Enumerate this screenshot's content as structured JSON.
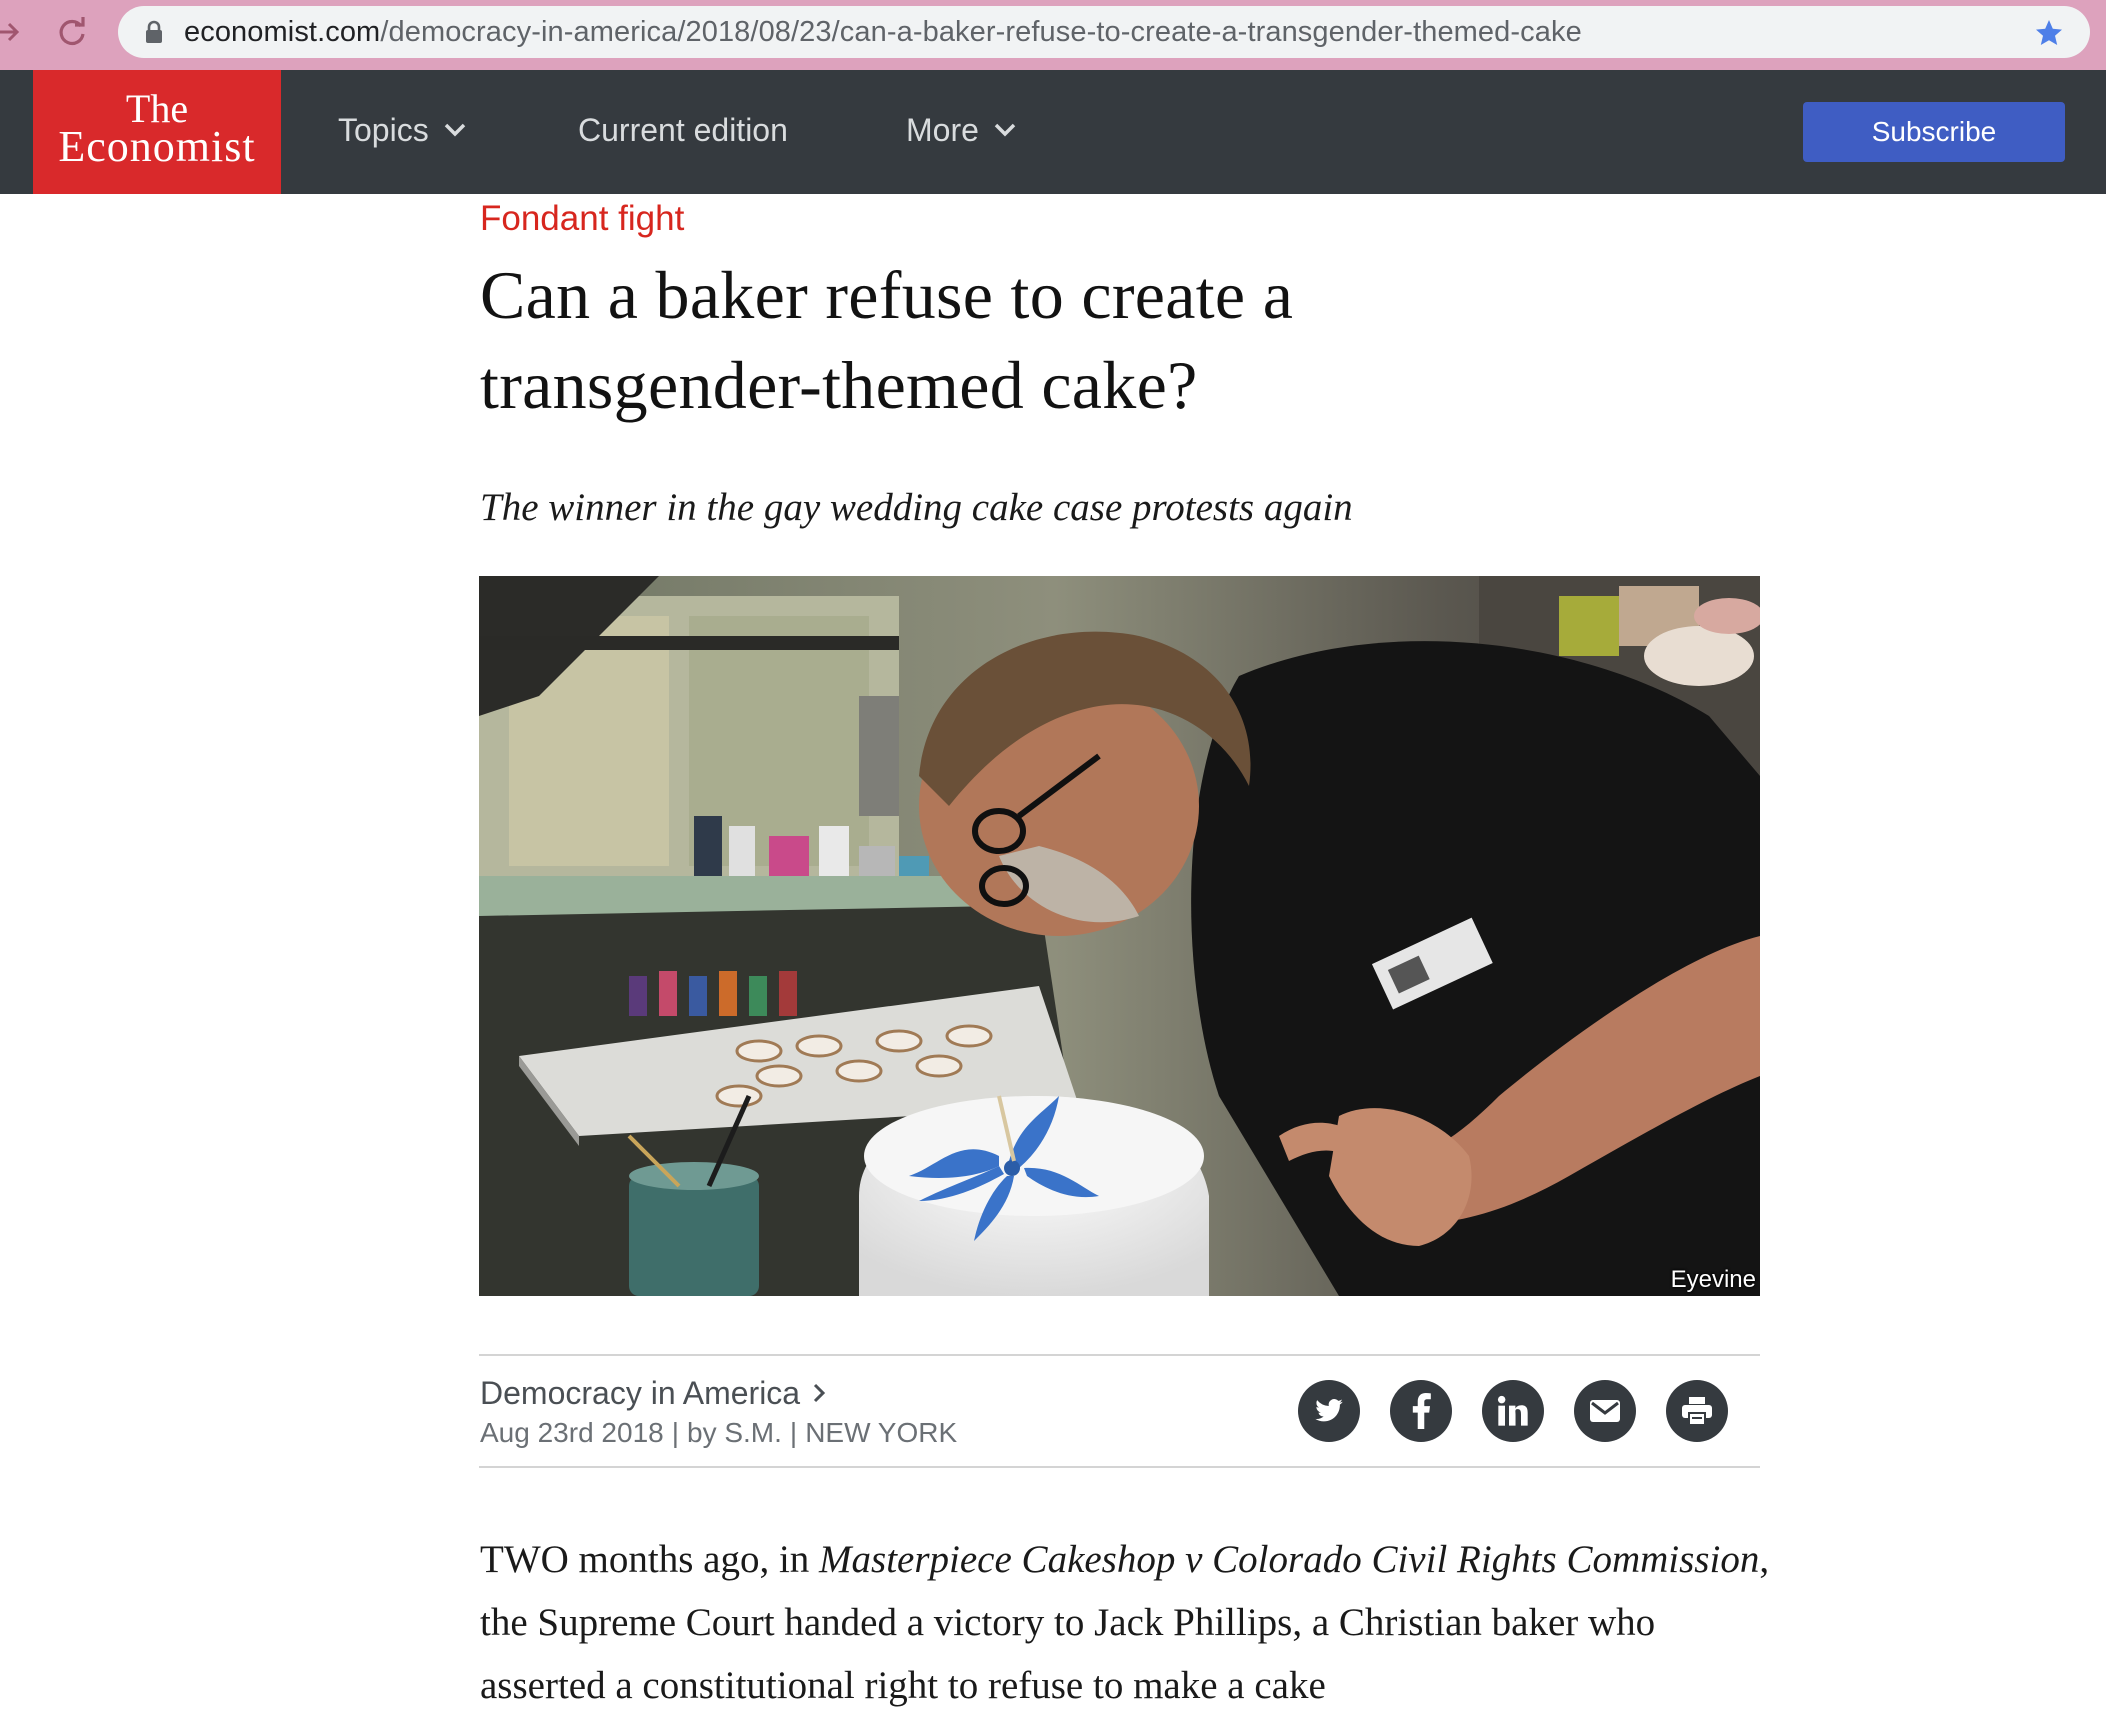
{
  "browser": {
    "url_host": "economist.com",
    "url_path": "/democracy-in-america/2018/08/23/can-a-baker-refuse-to-create-a-transgender-themed-cake"
  },
  "header": {
    "logo_line1": "The",
    "logo_line2": "Economist",
    "nav": {
      "topics": "Topics",
      "current_edition": "Current edition",
      "more": "More"
    },
    "subscribe_label": "Subscribe"
  },
  "article": {
    "rubric": "Fondant fight",
    "headline_line1": "Can a baker refuse to create a",
    "headline_line2": "transgender-themed cake?",
    "subheadline": "The winner in the gay wedding cake case protests again",
    "image_credit": "Eyevine",
    "section": "Democracy in America",
    "date": "Aug 23rd 2018",
    "byline": "by S.M.",
    "location": "NEW YORK",
    "body": {
      "p1_start": "TWO months ago, in ",
      "p1_case": "Masterpiece Cakeshop v Colorado Civil Rights Commission",
      "p1_after_case": ", the Supreme Court handed a victory to Jack Phillips, a Christian baker who asserted a constitutional right to refuse to make a cake"
    }
  },
  "share_icons": [
    "twitter-icon",
    "facebook-icon",
    "linkedin-icon",
    "email-icon",
    "print-icon"
  ],
  "colors": {
    "browser_bar": "#dda2bd",
    "header_bg": "#353a3f",
    "logo_red": "#d9292b",
    "rubric_red": "#d7261e",
    "subscribe_blue": "#3f5dc3"
  }
}
